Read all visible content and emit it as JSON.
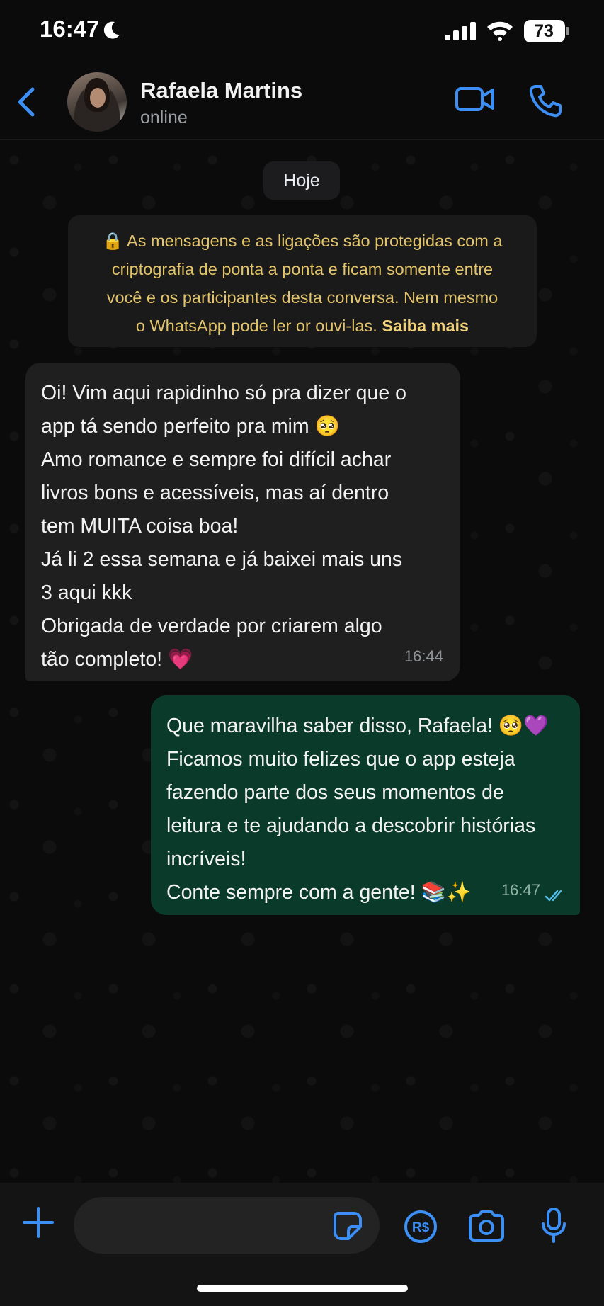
{
  "status_bar": {
    "time": "16:47",
    "battery": "73"
  },
  "header": {
    "contact_name": "Rafaela Martins",
    "contact_status": "online"
  },
  "chat": {
    "date_separator": "Hoje",
    "encryption_notice": {
      "line1": "🔒 As mensagens e as ligações são protegidas com a",
      "line2": "criptografia de ponta a ponta e ficam somente entre",
      "line3": "você e os participantes desta conversa. Nem mesmo",
      "line4": "o WhatsApp pode ler or ouvi-las.",
      "learn_more": "Saiba mais"
    },
    "messages": [
      {
        "direction": "incoming",
        "lines": [
          "Oi! Vim aqui rapidinho só pra dizer que o",
          "app tá sendo perfeito pra mim 🥺",
          "Amo romance e sempre foi difícil achar",
          "livros bons e acessíveis, mas aí dentro",
          "tem MUITA coisa boa!",
          "Já li 2 essa semana e já baixei mais uns",
          "3 aqui kkk",
          "Obrigada de verdade por criarem algo",
          "tão completo! 💗"
        ],
        "time": "16:44"
      },
      {
        "direction": "outgoing",
        "lines": [
          "Que maravilha saber disso, Rafaela! 🥺💜",
          "Ficamos muito felizes que o app esteja",
          "fazendo parte dos seus momentos de",
          "leitura e te ajudando a descobrir histórias",
          "incríveis!",
          "Conte sempre com a gente! 📚✨"
        ],
        "time": "16:47",
        "status": "read"
      }
    ]
  },
  "composer": {
    "placeholder": "",
    "value": ""
  },
  "colors": {
    "accent": "#3b8ff5",
    "incoming_bubble": "#1f1f1f",
    "outgoing_bubble": "#0a3a2a",
    "notice_text": "#e3c46a",
    "read_receipt": "#53bdeb"
  },
  "icons": [
    "moon-icon",
    "signal-icon",
    "wifi-icon",
    "battery-icon",
    "back-icon",
    "video-call-icon",
    "phone-call-icon",
    "plus-icon",
    "sticker-icon",
    "pix-icon",
    "camera-icon",
    "microphone-icon",
    "double-check-icon"
  ]
}
